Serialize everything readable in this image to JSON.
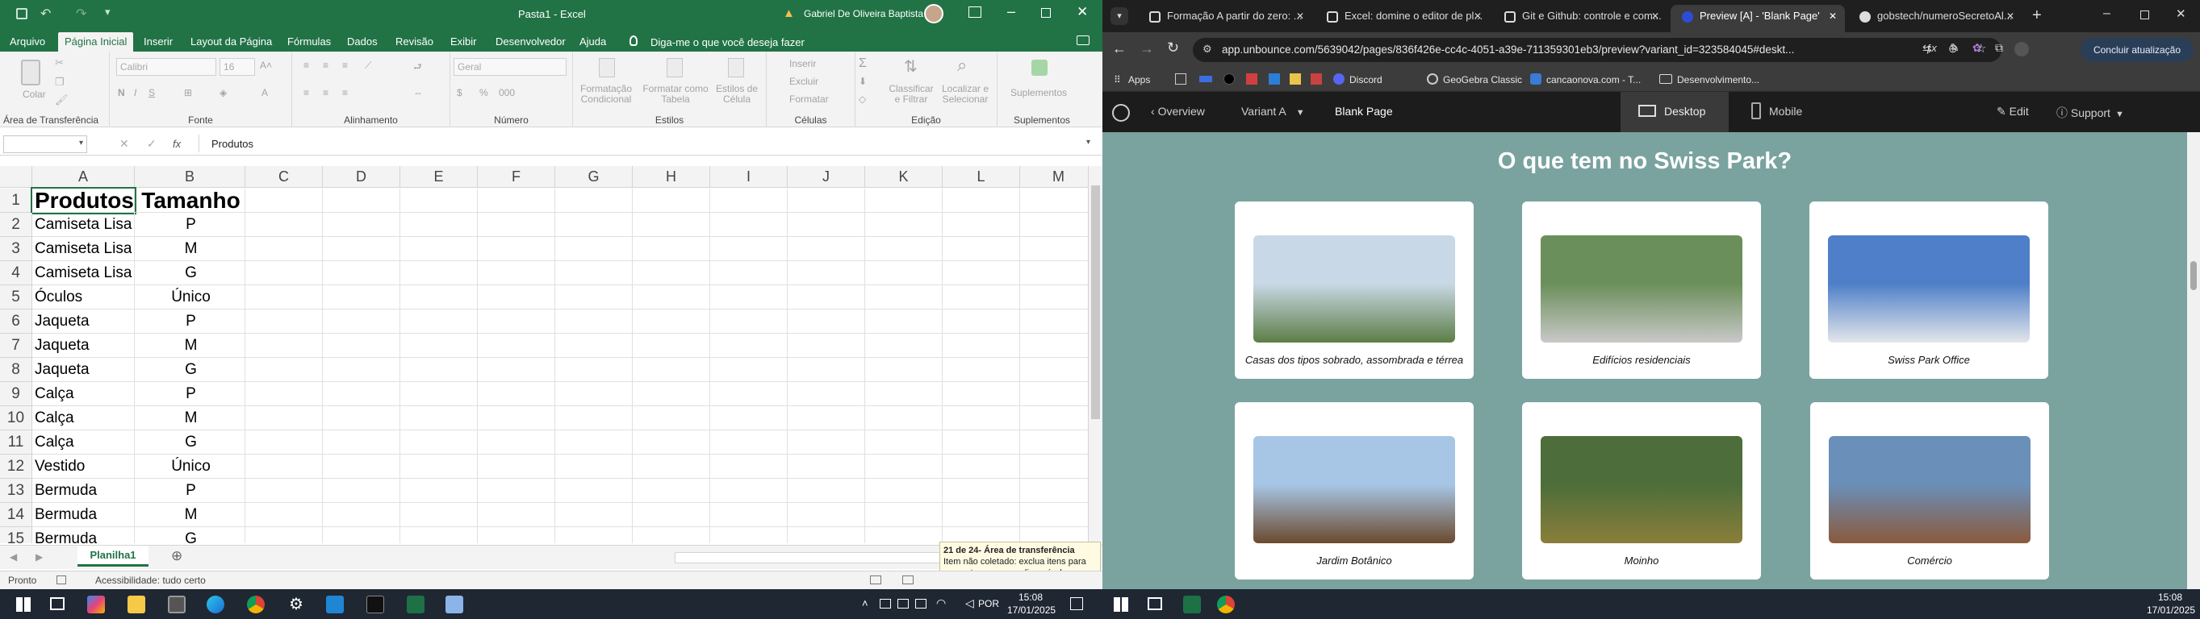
{
  "excel": {
    "title": "Pasta1  -  Excel",
    "user": "Gabriel De Oliveira Baptista",
    "tabs": [
      "Arquivo",
      "Página Inicial",
      "Inserir",
      "Layout da Página",
      "Fórmulas",
      "Dados",
      "Revisão",
      "Exibir",
      "Desenvolvedor",
      "Ajuda"
    ],
    "tell_me": "Diga-me o que você deseja fazer",
    "ribbon": {
      "font_name": "Calibri",
      "font_size": "16",
      "number_format": "Geral",
      "paste": "Colar",
      "groups": [
        "Área de Transferência",
        "Fonte",
        "Alinhamento",
        "Número",
        "Estilos",
        "Células",
        "Edição",
        "Suplementos"
      ],
      "styles": [
        "Formatação Condicional",
        "Formatar como Tabela",
        "Estilos de Célula"
      ],
      "cells": [
        "Inserir",
        "Excluir",
        "Formatar"
      ],
      "edit": [
        "Classificar e Filtrar",
        "Localizar e Selecionar"
      ],
      "addins": "Suplementos"
    },
    "formula": "Produtos",
    "fx": "fx",
    "columns": [
      "A",
      "B",
      "C",
      "D",
      "E",
      "F",
      "G",
      "H",
      "I",
      "J",
      "K",
      "L",
      "M"
    ],
    "rows": [
      [
        "1",
        "Produtos",
        "Tamanho"
      ],
      [
        "2",
        "Camiseta Lisa",
        "P"
      ],
      [
        "3",
        "Camiseta Lisa",
        "M"
      ],
      [
        "4",
        "Camiseta Lisa",
        "G"
      ],
      [
        "5",
        "Óculos",
        "Único"
      ],
      [
        "6",
        "Jaqueta",
        "P"
      ],
      [
        "7",
        "Jaqueta",
        "M"
      ],
      [
        "8",
        "Jaqueta",
        "G"
      ],
      [
        "9",
        "Calça",
        "P"
      ],
      [
        "10",
        "Calça",
        "M"
      ],
      [
        "11",
        "Calça",
        "G"
      ],
      [
        "12",
        "Vestido",
        "Único"
      ],
      [
        "13",
        "Bermuda",
        "P"
      ],
      [
        "14",
        "Bermuda",
        "M"
      ],
      [
        "15",
        "Bermuda",
        "G"
      ]
    ],
    "sheet": "Planilha1",
    "status": "Pronto",
    "accessibility": "Acessibilidade: tudo certo",
    "clipboard_tip": {
      "title": "21 de 24- Área de transferência",
      "line1": "Item não coletado: exclua itens para",
      "line2": "aumentar o espaço disponível"
    }
  },
  "browser": {
    "tabs": [
      "Formação A partir do zero: ...",
      "Excel: domine o editor de pl...",
      "Git e Github: controle e com...",
      "Preview [A] - 'Blank Page'",
      "gobstech/numeroSecretoAl..."
    ],
    "url": "app.unbounce.com/5639042/pages/836f426e-cc4c-4051-a39e-711359301eb3/preview?variant_id=323584045#deskt...",
    "update": "Concluir atualização",
    "bookmarks": [
      "Apps",
      "Discord",
      "GeoGebra Classic",
      "cancaonova.com - T...",
      "Desenvolvimento..."
    ],
    "unbounce": {
      "overview": "Overview",
      "variant": "Variant A",
      "page": "Blank Page",
      "desktop": "Desktop",
      "mobile": "Mobile",
      "edit": "Edit",
      "support": "Support"
    },
    "heading": "O que tem no Swiss Park?",
    "cards": [
      "Casas dos tipos sobrado, assombrada e térrea",
      "Edifícios residenciais",
      "Swiss Park Office",
      "Jardim Botânico",
      "Moinho",
      "Comércio"
    ]
  },
  "taskbar": {
    "left": {
      "lang": "POR",
      "time": "15:08",
      "date": "17/01/2025"
    },
    "right": {
      "time": "15:08",
      "date": "17/01/2025"
    }
  },
  "colors": {
    "excel_green": "#217346",
    "page_bg": "#7aa3a0",
    "taskbar": "#1f2733"
  }
}
